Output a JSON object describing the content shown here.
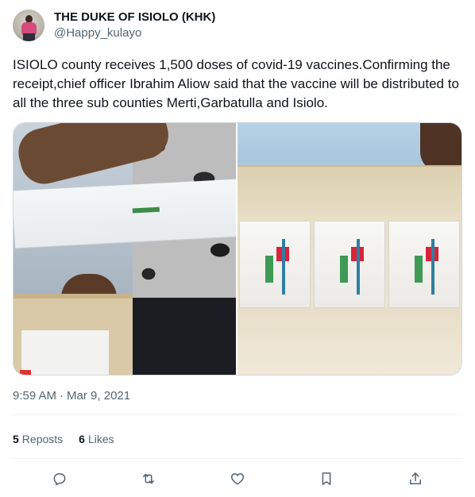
{
  "author": {
    "display_name": "THE DUKE OF ISIOLO (KHK)",
    "handle": "@Happy_kulayo"
  },
  "tweet": {
    "text": "ISIOLO county receives 1,500 doses of covid-19 vaccines.Confirming the receipt,chief officer Ibrahim Aliow said that the vaccine will be distributed to all the three sub counties Merti,Garbatulla and Isiolo.",
    "time": "9:59 AM",
    "separator": "·",
    "date": "Mar 9, 2021"
  },
  "stats": {
    "reposts_count": "5",
    "reposts_label": "Reposts",
    "likes_count": "6",
    "likes_label": "Likes"
  },
  "icons": {
    "reply": "reply-icon",
    "repost": "repost-icon",
    "like": "heart-icon",
    "bookmark": "bookmark-icon",
    "share": "share-icon"
  },
  "colors": {
    "text_primary": "#0f1419",
    "text_secondary": "#536471",
    "divider": "#eff3f4",
    "media_border": "#cfd9de"
  }
}
